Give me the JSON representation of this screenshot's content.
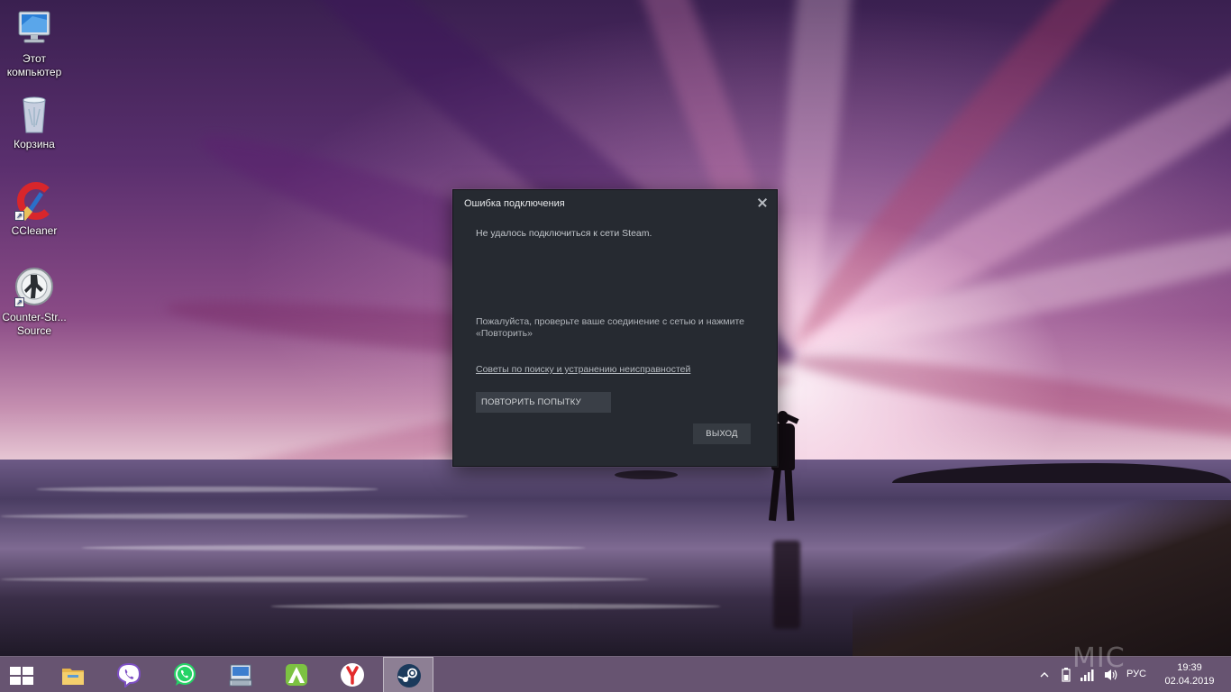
{
  "desktop": {
    "icons": [
      {
        "label": "Этот компьютер",
        "icon": "computer-icon"
      },
      {
        "label": "Корзина",
        "icon": "recycle-bin-icon"
      },
      {
        "label": "CCleaner",
        "icon": "ccleaner-icon"
      },
      {
        "label": "Counter-Str... Source",
        "icon": "counter-strike-icon"
      }
    ]
  },
  "dialog": {
    "title": "Ошибка подключения",
    "message": "Не удалось подключиться к сети Steam.",
    "hint": "Пожалуйста, проверьте ваше соединение с сетью и нажмите «Повторить»",
    "link": "Советы по поиску и устранению неисправностей",
    "retry_label": "ПОВТОРИТЬ ПОПЫТКУ",
    "exit_label": "ВЫХОД",
    "colors": {
      "background": "#262a31",
      "button": "#3a3f47"
    }
  },
  "taskbar": {
    "apps": [
      {
        "name": "start-button",
        "icon": "windows-logo-icon"
      },
      {
        "name": "file-explorer",
        "icon": "folder-icon"
      },
      {
        "name": "viber",
        "icon": "viber-icon"
      },
      {
        "name": "whatsapp",
        "icon": "whatsapp-icon"
      },
      {
        "name": "on-screen-keyboard",
        "icon": "keyboard-icon"
      },
      {
        "name": "android-app",
        "icon": "a-logo-icon"
      },
      {
        "name": "yandex-browser",
        "icon": "yandex-icon"
      },
      {
        "name": "steam",
        "icon": "steam-icon",
        "active": true
      }
    ],
    "tray": {
      "language": "РУС",
      "time": "19:39",
      "date": "02.04.2019",
      "watermark": "MIC"
    }
  }
}
